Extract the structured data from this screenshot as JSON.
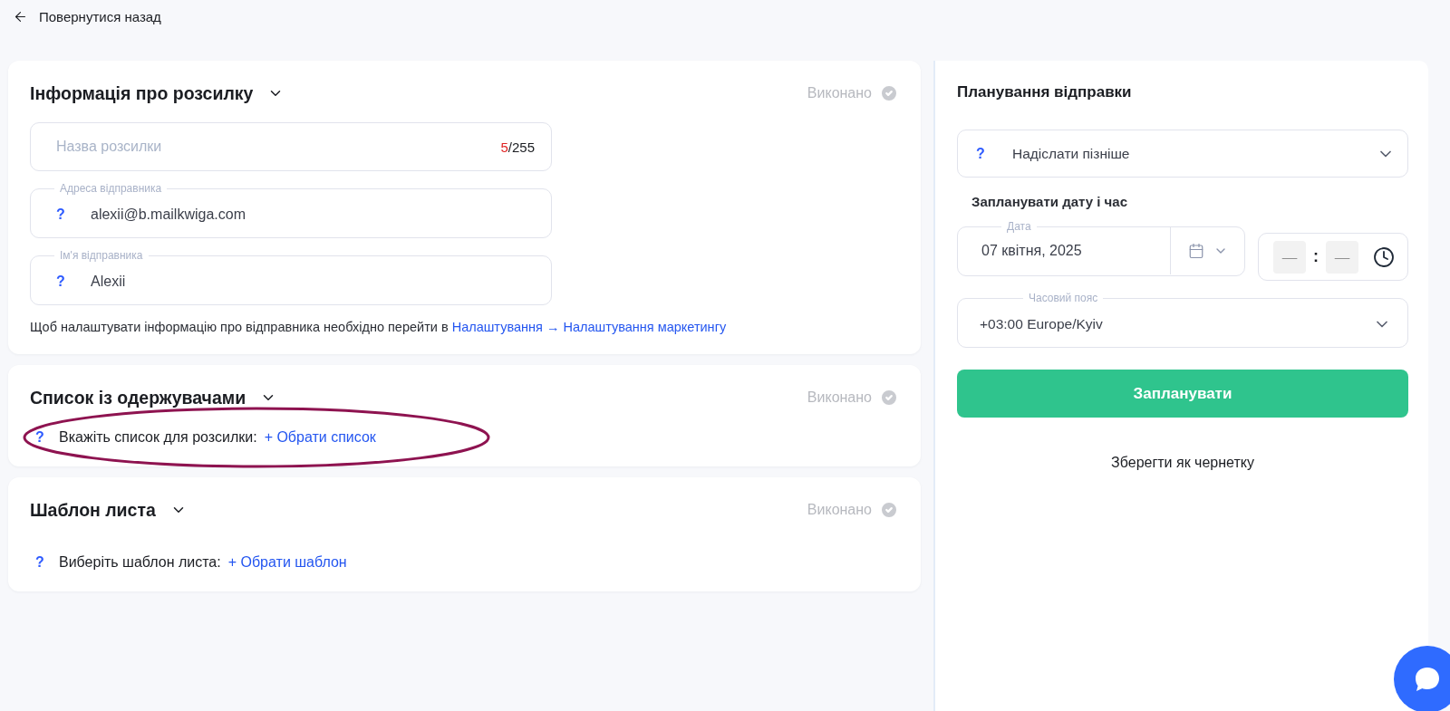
{
  "back_link": {
    "label": "Повернутися назад"
  },
  "sections": [
    {
      "title": "Інформація про розсилку",
      "status": "Виконано",
      "fields": [
        {
          "kind": "counter",
          "placeholder": "Назва розсилки",
          "count": "5",
          "limit": "/255"
        },
        {
          "kind": "labeled",
          "label": "Адреса відправника",
          "help": "?",
          "value": "alexii@b.mailkwiga.com"
        },
        {
          "kind": "labeled",
          "label": "Ім'я відправника",
          "help": "?",
          "value": "Alexii"
        }
      ],
      "note": {
        "text": "Щоб налаштувати інформацію про відправника необхідно перейти в",
        "link": "Налаштування → Налаштування маркетингу"
      }
    },
    {
      "title": "Список із одержувачами",
      "status": "Виконано",
      "picker": {
        "help": "?",
        "label": "Вкажіть список для розсилки:",
        "link": "+ Обрати список",
        "circled": true
      }
    },
    {
      "title": "Шаблон листа",
      "status": "Виконано",
      "picker": {
        "help": "?",
        "label": "Виберіть шаблон листа:",
        "link": "+ Обрати шаблон",
        "circled": false
      }
    }
  ],
  "schedule": {
    "title": "Планування відправки",
    "mode": {
      "help": "?",
      "value": "Надіслати пізніше"
    },
    "subheading": "Запланувати дату і час",
    "date": {
      "label": "Дата",
      "value": "07 квітня, 2025"
    },
    "time": {
      "hours_placeholder": "––",
      "separator": ":",
      "minutes_placeholder": "––"
    },
    "timezone": {
      "label": "Часовий пояс",
      "value": "+03:00 Europe/Kyiv"
    },
    "primary_button": "Запланувати",
    "secondary_button": "Зберегти як чернетку"
  }
}
